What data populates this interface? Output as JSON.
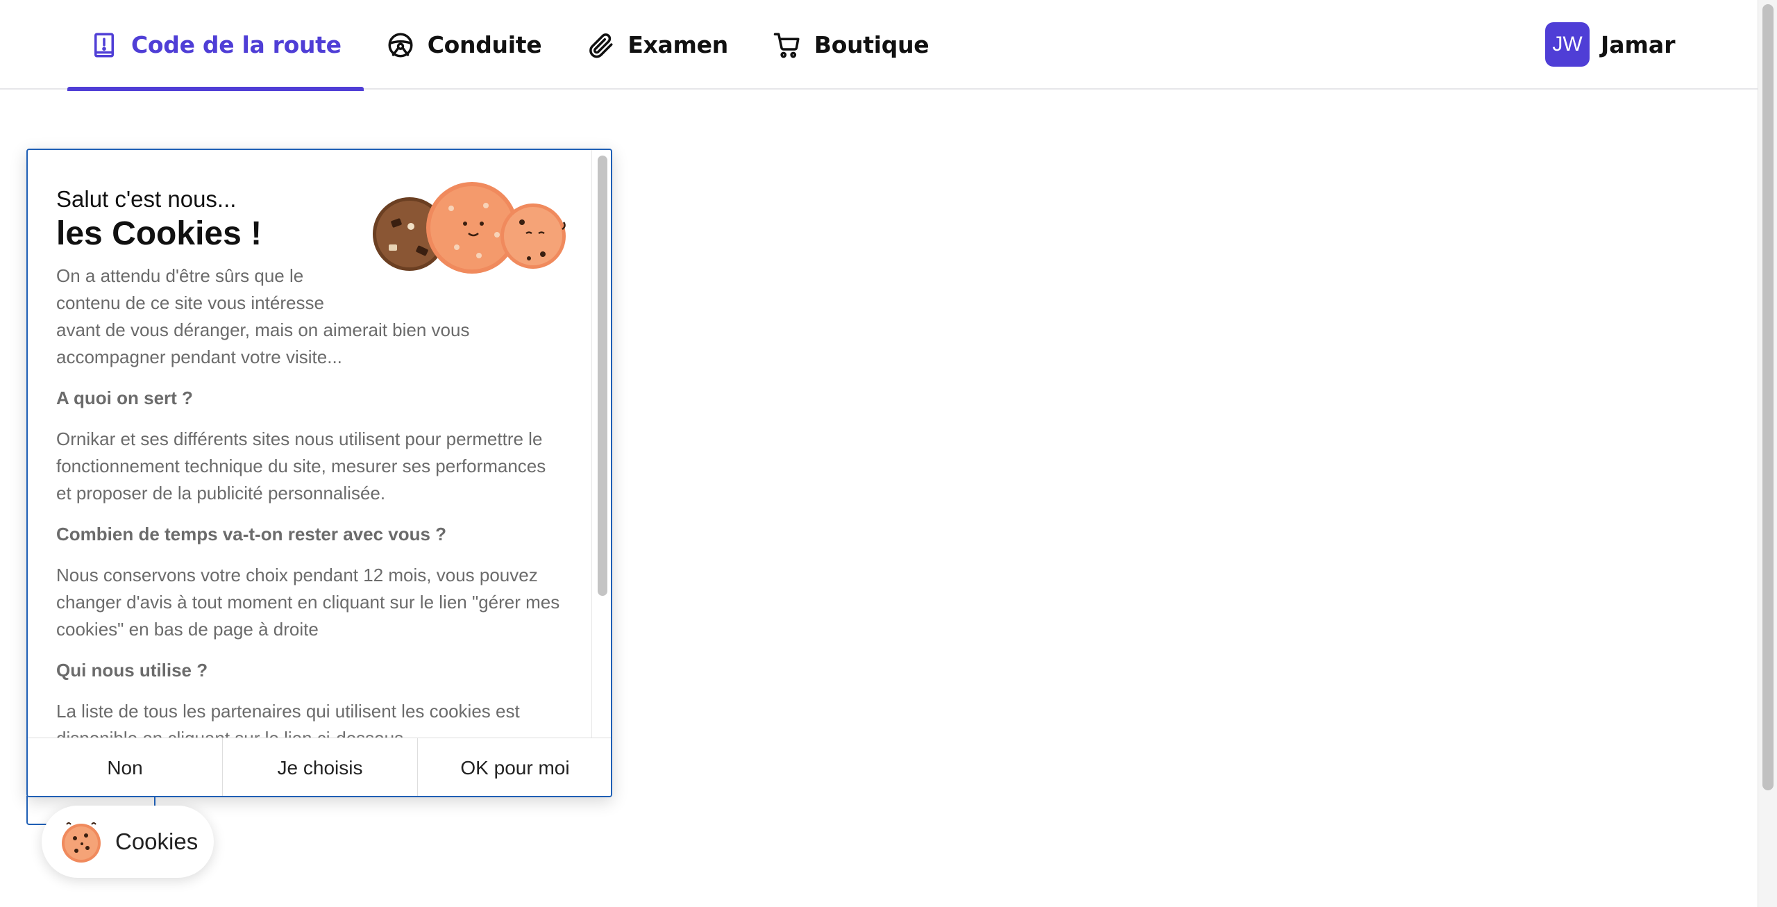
{
  "nav": {
    "items": [
      {
        "label": "Code de la route",
        "icon": "road-sign-icon",
        "active": true
      },
      {
        "label": "Conduite",
        "icon": "steering-wheel-icon",
        "active": false
      },
      {
        "label": "Examen",
        "icon": "paperclip-icon",
        "active": false
      },
      {
        "label": "Boutique",
        "icon": "shopping-cart-icon",
        "active": false
      }
    ],
    "accent_color": "#4f3ed6"
  },
  "user": {
    "initials": "JW",
    "name": "Jamar"
  },
  "cookie_panel": {
    "greeting": "Salut c'est nous...",
    "headline": "les Cookies !",
    "intro_part1": "On a attendu d'être sûrs que le contenu de ce site vous intéresse",
    "intro_part2": "avant de vous déranger, mais on aimerait bien vous accompagner pendant votre visite...",
    "section1_title": "A quoi on sert ?",
    "section1_text": "Ornikar et ses différents sites nous utilisent pour permettre le fonctionnement technique du site, mesurer ses performances et proposer de la publicité personnalisée.",
    "section2_title": "Combien de temps va-t-on rester avec vous ?",
    "section2_text": "Nous conservons votre choix pendant 12 mois, vous pouvez changer d'avis à tout moment en cliquant sur le lien \"gérer mes cookies\" en bas de page à droite",
    "section3_title": "Qui nous utilise ?",
    "section3_text": "La liste de tous les partenaires qui utilisent les cookies est disponible en cliquant sur le lien ci-dessous.",
    "buttons": {
      "reject": "Non",
      "choose": "Je choisis",
      "accept": "OK pour moi"
    },
    "border_color": "#1f5fb5"
  },
  "cookie_pill": {
    "label": "Cookies"
  }
}
